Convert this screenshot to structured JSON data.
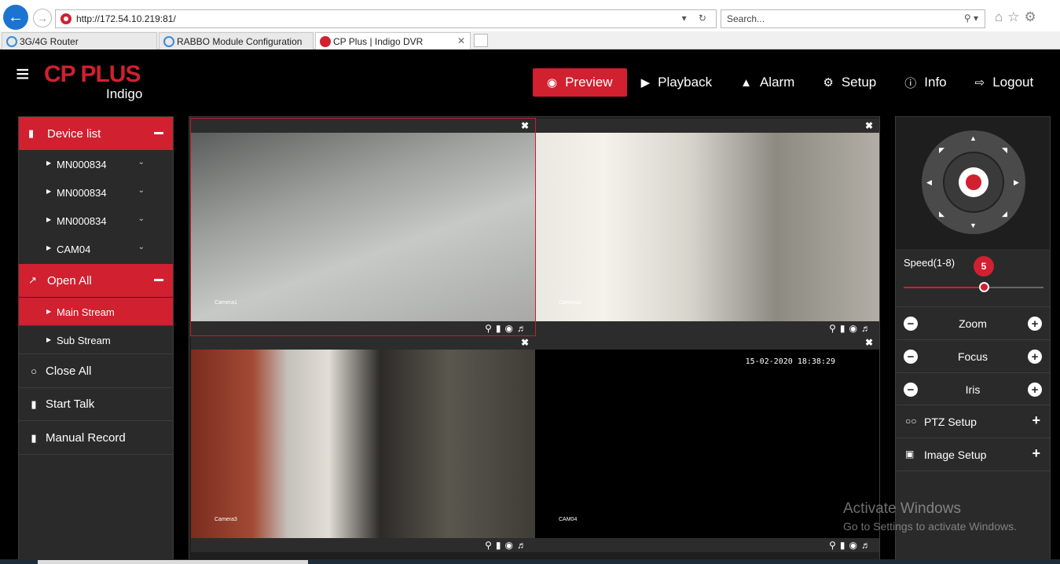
{
  "browser": {
    "url": "http://172.54.10.219:81/",
    "search_placeholder": "Search...",
    "tabs": [
      {
        "label": "3G/4G Router"
      },
      {
        "label": "RABBO Module Configuration"
      },
      {
        "label": "CP Plus | Indigo DVR"
      }
    ]
  },
  "app": {
    "logo_text": "CP PLUS",
    "logo_sub": "Indigo",
    "nav": [
      {
        "label": "Preview",
        "icon": "eye-icon"
      },
      {
        "label": "Playback",
        "icon": "play-icon"
      },
      {
        "label": "Alarm",
        "icon": "bell-icon"
      },
      {
        "label": "Setup",
        "icon": "gear-icon"
      },
      {
        "label": "Info",
        "icon": "info-icon"
      },
      {
        "label": "Logout",
        "icon": "logout-icon"
      }
    ],
    "accent_color": "#d1202f"
  },
  "left_panel": {
    "device_list_label": "Device list",
    "devices": [
      {
        "label": "MN000834"
      },
      {
        "label": "MN000834"
      },
      {
        "label": "MN000834"
      },
      {
        "label": "CAM04"
      }
    ],
    "open_all_label": "Open All",
    "streams": [
      {
        "label": "Main Stream"
      },
      {
        "label": "Sub Stream"
      }
    ],
    "close_all_label": "Close All",
    "start_talk_label": "Start Talk",
    "manual_record_label": "Manual Record"
  },
  "video": {
    "panes": [
      {
        "timestamp": "",
        "camera": "Camera1"
      },
      {
        "timestamp": "",
        "camera": "Camera2"
      },
      {
        "timestamp": "",
        "camera": "Camera3"
      },
      {
        "timestamp": "15-02-2020 18:38:29",
        "camera": "CAM04"
      }
    ]
  },
  "right_panel": {
    "speed_label": "Speed(1-8)",
    "speed_value": "5",
    "speed_min": 1,
    "speed_max": 8,
    "controls": [
      {
        "label": "Zoom"
      },
      {
        "label": "Focus"
      },
      {
        "label": "Iris"
      }
    ],
    "ptz_setup_label": "PTZ Setup",
    "image_setup_label": "Image Setup"
  },
  "watermark": {
    "title": "Activate Windows",
    "subtitle": "Go to Settings to activate Windows."
  }
}
